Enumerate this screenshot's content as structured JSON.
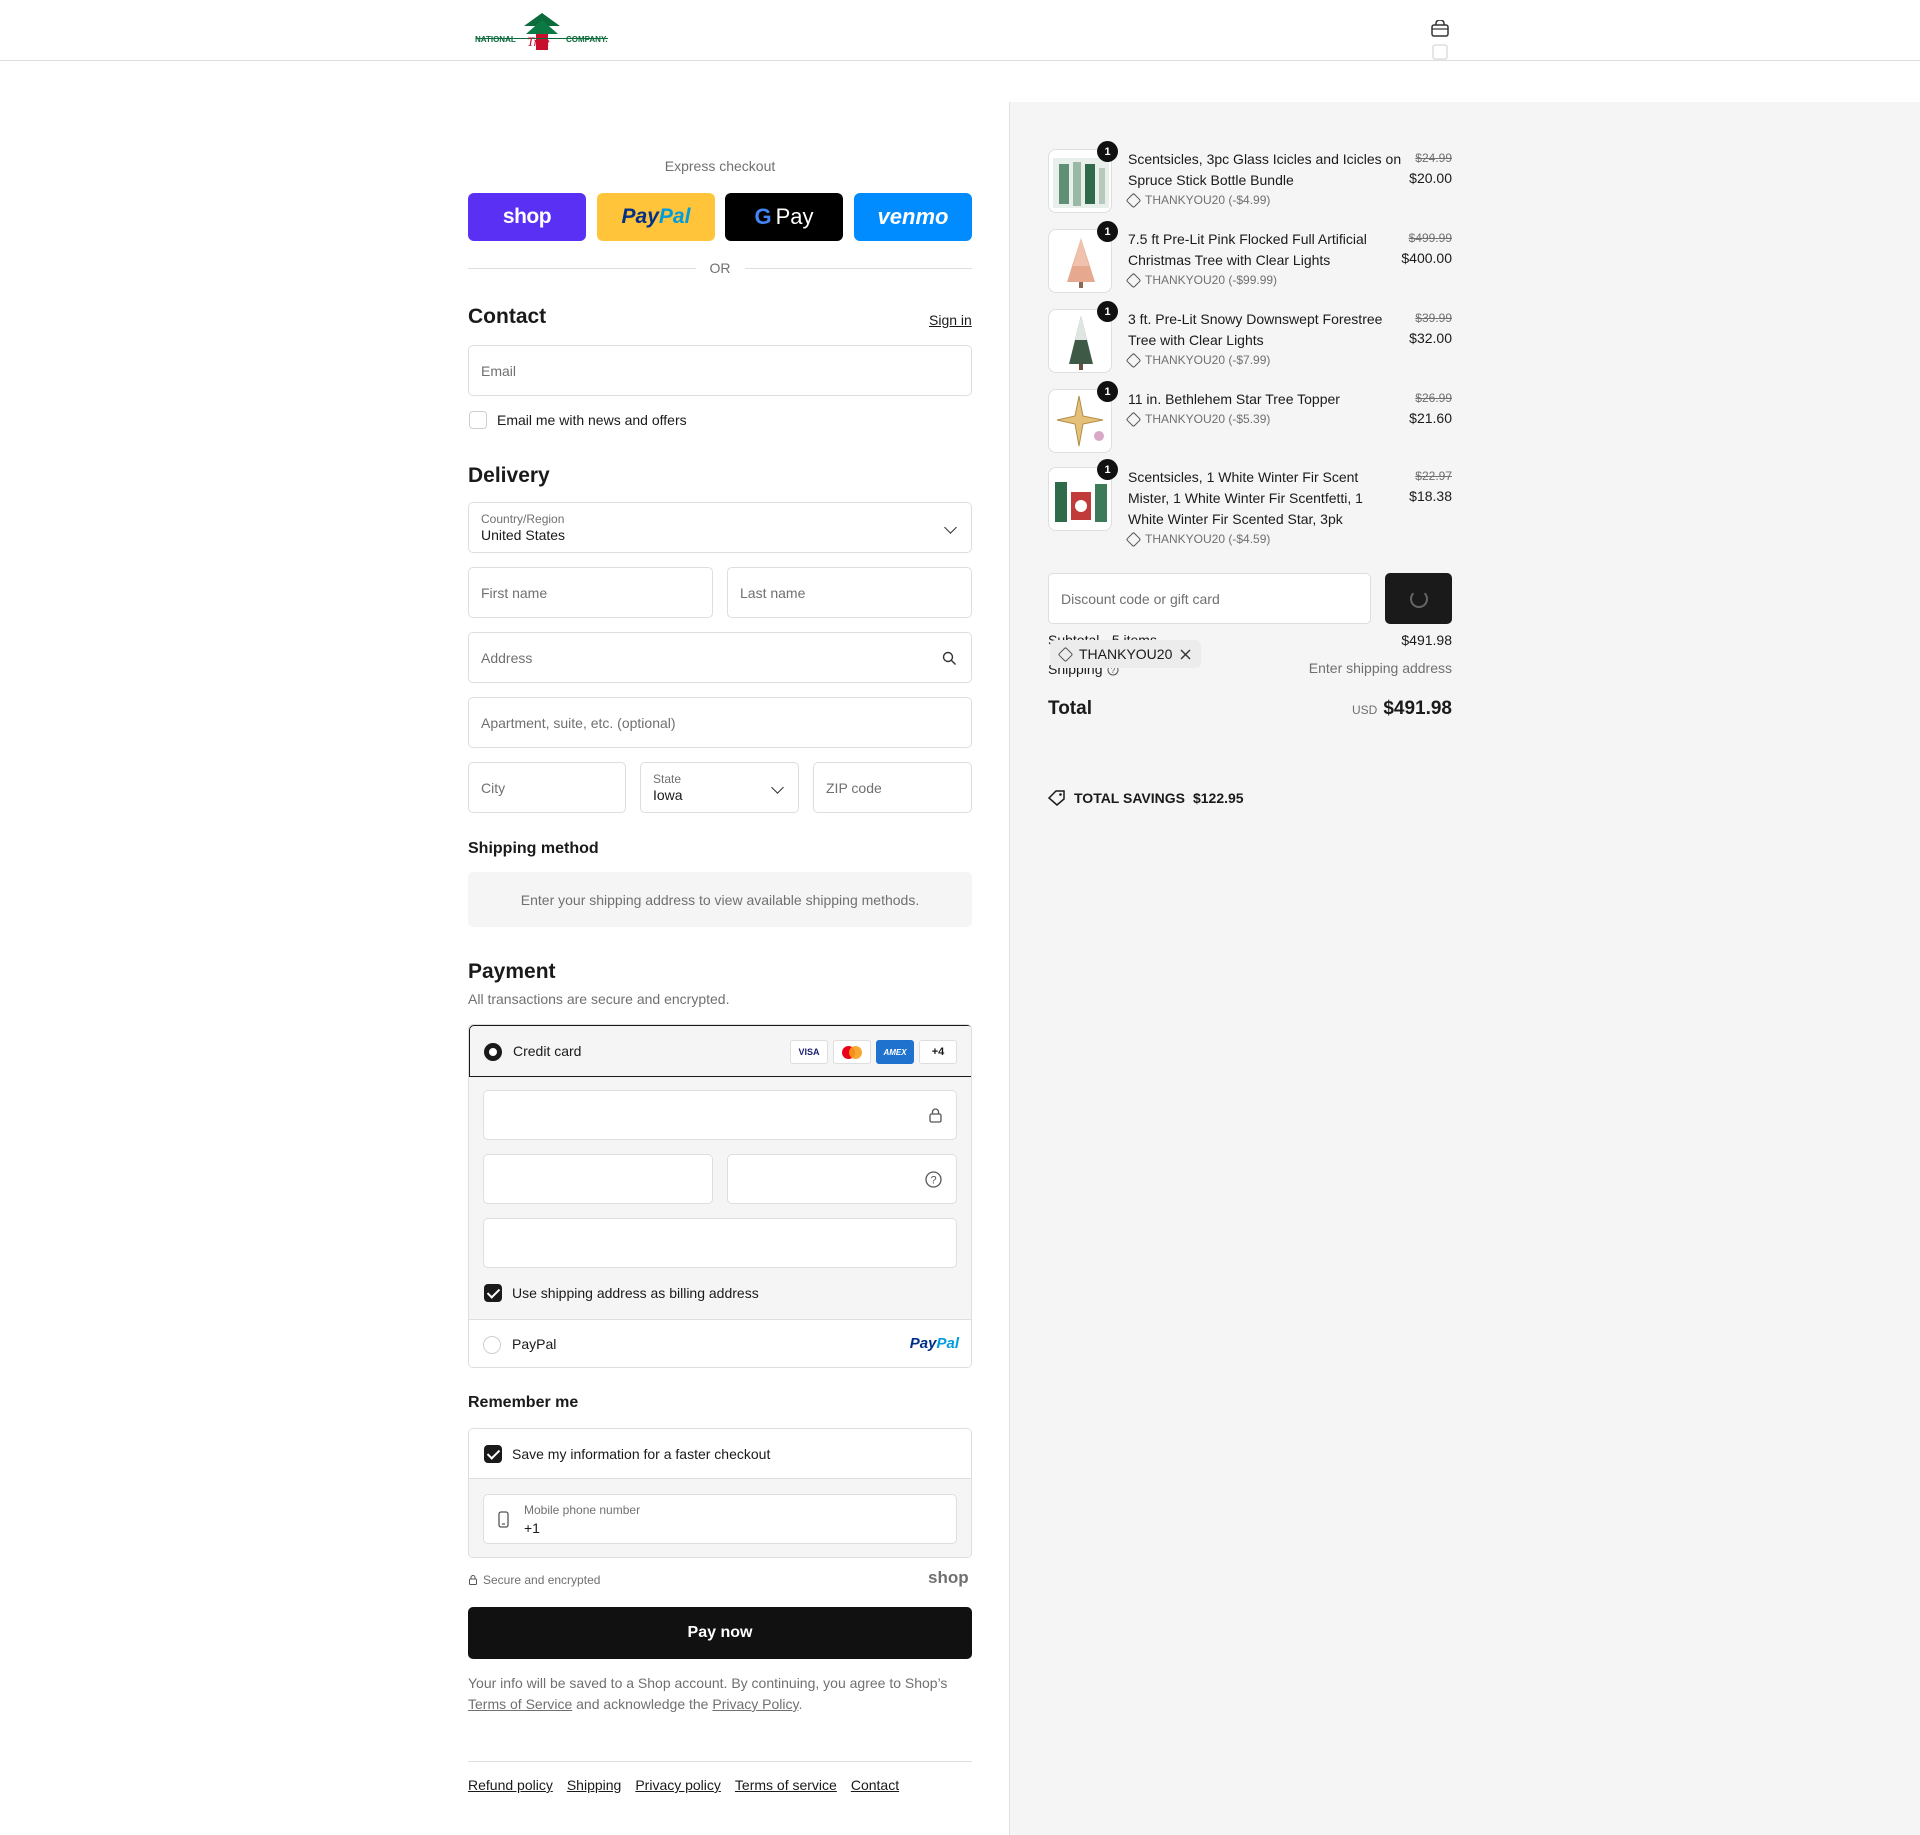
{
  "header": {
    "logo_left": "NATIONAL",
    "logo_mid": "Tree",
    "logo_right": "COMPANY."
  },
  "express": {
    "title": "Express checkout",
    "shop": "shop",
    "paypal_a": "Pay",
    "paypal_b": "Pal",
    "gpay_g": "G",
    "gpay": "Pay",
    "venmo": "venmo",
    "or": "OR"
  },
  "contact": {
    "title": "Contact",
    "sign_in": "Sign in",
    "email_placeholder": "Email",
    "news_label": "Email me with news and offers"
  },
  "delivery": {
    "title": "Delivery",
    "country_label": "Country/Region",
    "country_value": "United States",
    "first_name": "First name",
    "last_name": "Last name",
    "address": "Address",
    "apartment": "Apartment, suite, etc. (optional)",
    "city": "City",
    "state_label": "State",
    "state_value": "Iowa",
    "zip": "ZIP code"
  },
  "shipping_method": {
    "title": "Shipping method",
    "message": "Enter your shipping address to view available shipping methods."
  },
  "payment": {
    "title": "Payment",
    "subtitle": "All transactions are secure and encrypted.",
    "credit_card": "Credit card",
    "visa": "VISA",
    "amex": "AMEX",
    "more": "+4",
    "billing_label": "Use shipping address as billing address",
    "paypal": "PayPal",
    "paypal_logo_a": "Pay",
    "paypal_logo_b": "Pal"
  },
  "remember": {
    "title": "Remember me",
    "save_label": "Save my information for a faster checkout",
    "phone_label": "Mobile phone number",
    "phone_value": "+1",
    "secure": "Secure and encrypted",
    "shop": "shop"
  },
  "pay_now": "Pay now",
  "legal": {
    "text1": "Your info will be saved to a Shop account. By continuing, you agree to Shop’s",
    "terms": "Terms of Service",
    "text2": "and acknowledge the",
    "privacy": "Privacy Policy",
    "period": "."
  },
  "footer": [
    "Refund policy",
    "Shipping",
    "Privacy policy",
    "Terms of service",
    "Contact"
  ],
  "cart": {
    "items": [
      {
        "qty": "1",
        "name": "Scentsicles, 3pc Glass Icicles and Icicles on Spruce Stick Bottle Bundle",
        "discount": "THANKYOU20 (-$4.99)",
        "original": "$24.99",
        "price": "$20.00"
      },
      {
        "qty": "1",
        "name": "7.5 ft Pre-Lit Pink Flocked Full Artificial Christmas Tree with Clear Lights",
        "discount": "THANKYOU20 (-$99.99)",
        "original": "$499.99",
        "price": "$400.00"
      },
      {
        "qty": "1",
        "name": "3 ft. Pre-Lit Snowy Downswept Forestree Tree with Clear Lights",
        "discount": "THANKYOU20 (-$7.99)",
        "original": "$39.99",
        "price": "$32.00"
      },
      {
        "qty": "1",
        "name": "11 in. Bethlehem Star Tree Topper",
        "discount": "THANKYOU20 (-$5.39)",
        "original": "$26.99",
        "price": "$21.60"
      },
      {
        "qty": "1",
        "name": "Scentsicles, 1 White Winter Fir Scent Mister, 1 White Winter Fir Scentfetti, 1 White Winter Fir Scented Star, 3pk",
        "discount": "THANKYOU20 (-$4.59)",
        "original": "$22.97",
        "price": "$18.38"
      }
    ],
    "discount_placeholder": "Discount code or gift card",
    "subtotal_label": "Subtotal · 5 items",
    "subtotal_value": "$491.98",
    "code_chip": "THANKYOU20",
    "shipping_label": "Shipping",
    "shipping_value": "Enter shipping address",
    "total_label": "Total",
    "currency": "USD",
    "total_value": "$491.98",
    "savings_label": "TOTAL SAVINGS",
    "savings_value": "$122.95"
  },
  "colors": {
    "shop": "#5a31f4",
    "paypal": "#ffc439",
    "gpay": "#000000",
    "venmo": "#008cff"
  }
}
